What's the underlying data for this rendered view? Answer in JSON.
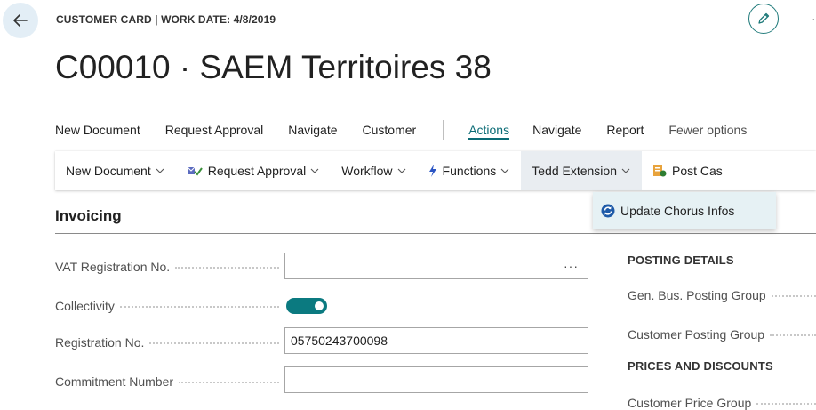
{
  "header": {
    "context": "CUSTOMER CARD | WORK DATE: 4/8/2019",
    "title": "C00010 · SAEM Territoires 38"
  },
  "action_bar": {
    "items": [
      "New Document",
      "Request Approval",
      "Navigate",
      "Customer"
    ],
    "tabs": [
      "Actions",
      "Navigate",
      "Report"
    ],
    "fewer_options": "Fewer options"
  },
  "ribbon": {
    "new_document": "New Document",
    "request_approval": "Request Approval",
    "workflow": "Workflow",
    "functions": "Functions",
    "tedd_extension": "Tedd Extension",
    "post_cash": "Post Cas"
  },
  "dropdown": {
    "update_chorus": "Update Chorus Infos"
  },
  "section": {
    "title": "Invoicing"
  },
  "fields": {
    "vat_label": "VAT Registration No.",
    "vat_value": "",
    "vat_ellipsis": "···",
    "collectivity_label": "Collectivity",
    "collectivity_on": true,
    "registration_label": "Registration No.",
    "registration_value": "05750243700098",
    "commitment_label": "Commitment Number",
    "commitment_value": ""
  },
  "right_panel": {
    "posting_details": "POSTING DETAILS",
    "gen_bus_label": "Gen. Bus. Posting Group",
    "customer_posting_label": "Customer Posting Group",
    "prices_discounts": "PRICES AND DISCOUNTS",
    "customer_price_label": "Customer Price Group"
  },
  "colors": {
    "accent": "#0a6b75",
    "toggle_on": "#0b7a80",
    "dropdown_bg": "#e6f1f4"
  }
}
